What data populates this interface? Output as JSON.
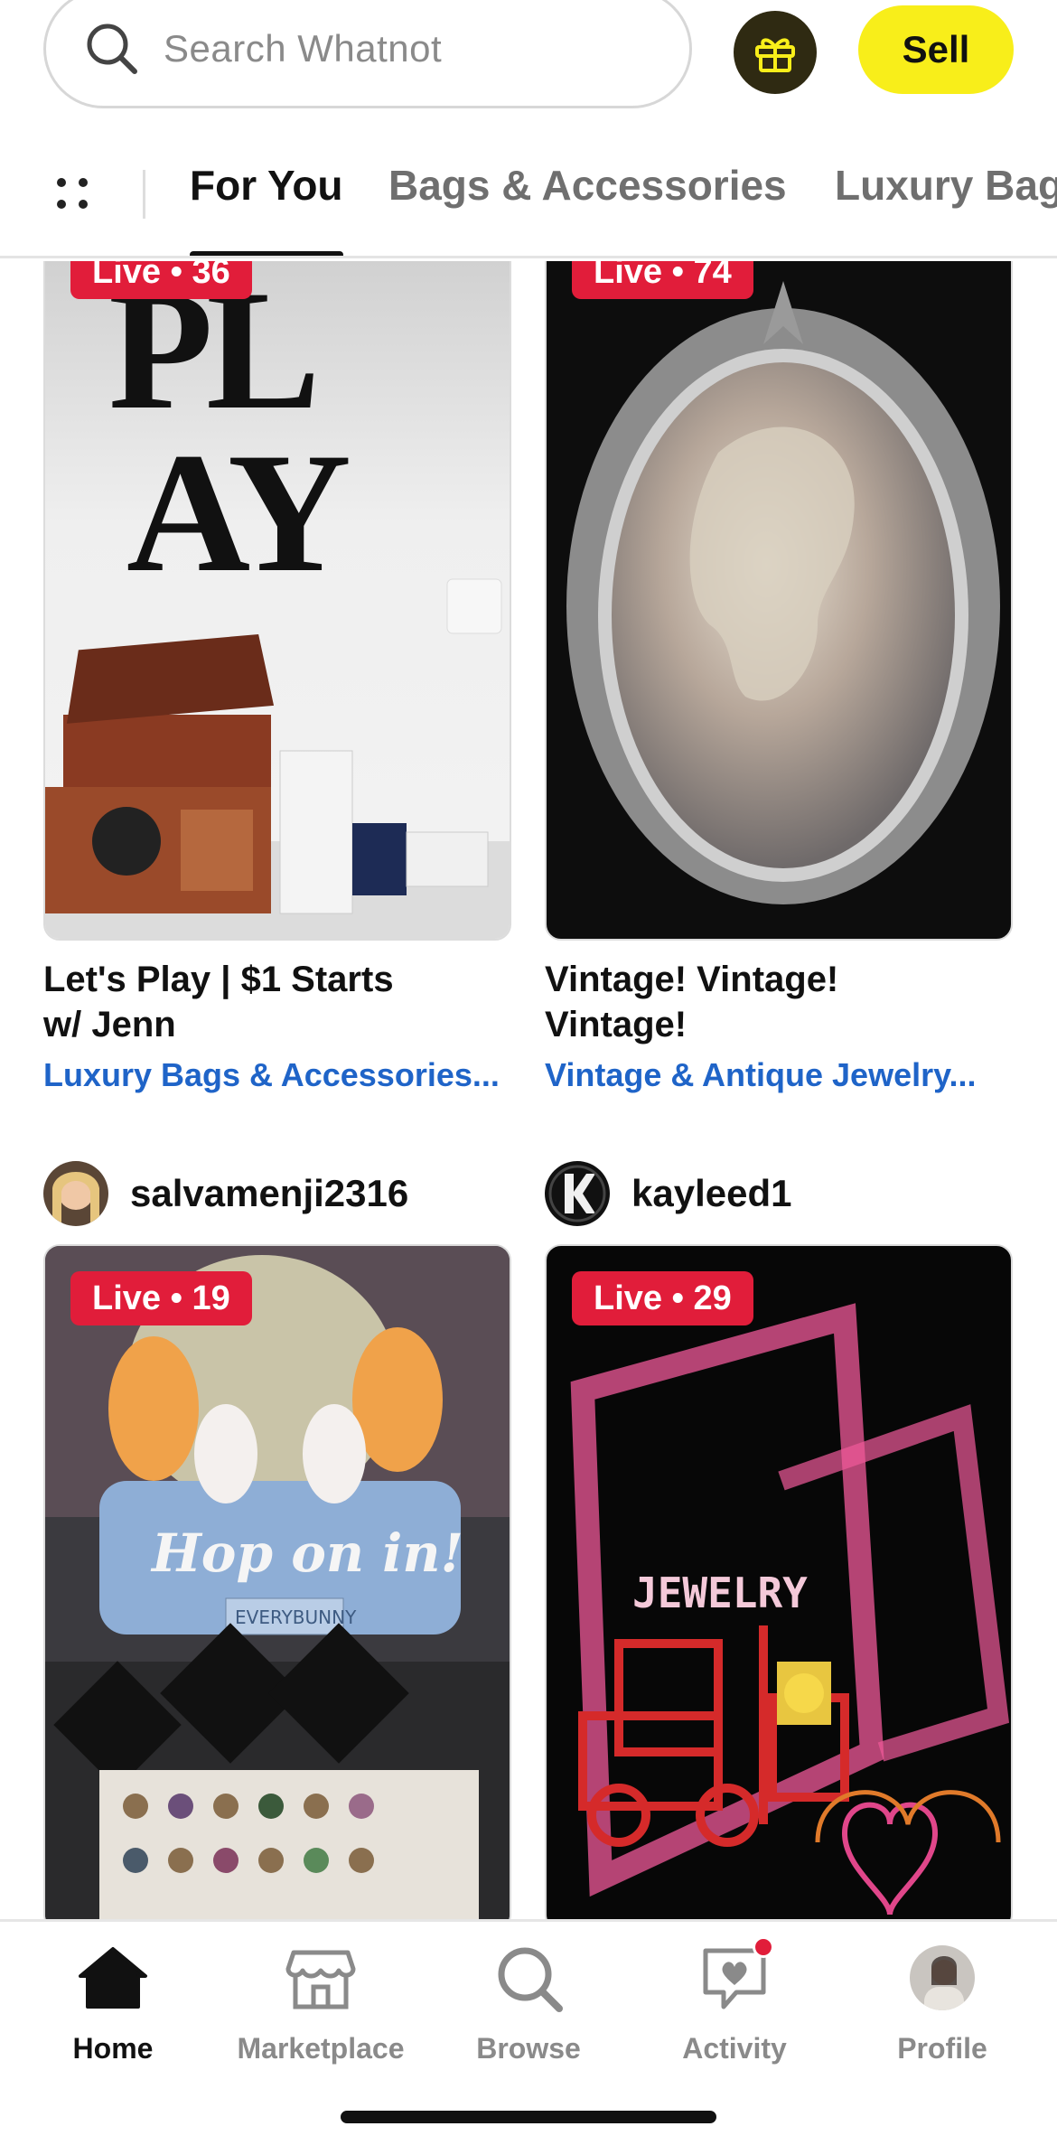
{
  "header": {
    "search_placeholder": "Search Whatnot",
    "sell_label": "Sell",
    "gift_icon": "gift-icon",
    "accent_color": "#f8ee1a"
  },
  "tabs": [
    {
      "label": "For You",
      "active": true
    },
    {
      "label": "Bags & Accessories",
      "active": false
    },
    {
      "label": "Luxury Bag",
      "active": false
    }
  ],
  "feed": {
    "cards": [
      {
        "live_badge": "Live • 36",
        "title_line1": "Let's Play | $1 Starts",
        "title_line2": "w/ Jenn",
        "category": "Luxury Bags & Accessories...",
        "image_text": "PL AY"
      },
      {
        "live_badge": "Live • 74",
        "title_line1": "Vintage! Vintage!",
        "title_line2": "Vintage!",
        "category": "Vintage & Antique Jewelry..."
      },
      {
        "seller": "salvamenji2316",
        "live_badge": "Live • 19",
        "image_text": "Hop on in!",
        "image_subtext": "EVERYBUNNY"
      },
      {
        "seller": "kayleed1",
        "live_badge": "Live • 29",
        "image_text": "JEWELRY"
      }
    ]
  },
  "bottom_nav": [
    {
      "label": "Home",
      "icon": "home-icon",
      "active": true
    },
    {
      "label": "Marketplace",
      "icon": "storefront-icon",
      "active": false
    },
    {
      "label": "Browse",
      "icon": "search-icon",
      "active": false
    },
    {
      "label": "Activity",
      "icon": "activity-chat-heart-icon",
      "active": false,
      "has_notification": true
    },
    {
      "label": "Profile",
      "icon": "profile-avatar",
      "active": false
    }
  ],
  "colors": {
    "live_badge": "#e11d3a",
    "category_link": "#1f64c8"
  }
}
